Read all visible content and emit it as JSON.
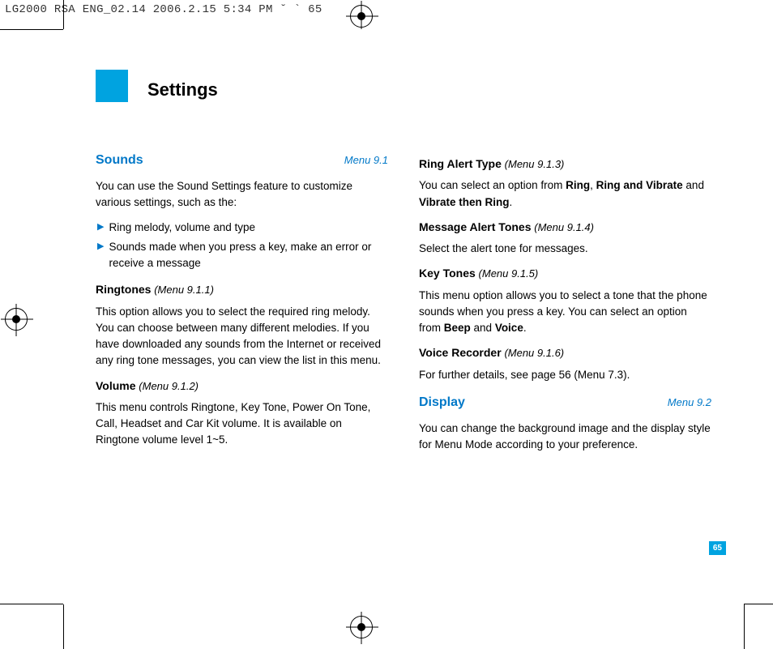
{
  "header": "LG2000 RSA ENG_02.14  2006.2.15 5:34 PM  ˘ ` 65",
  "page_title": "Settings",
  "page_number": "65",
  "left": {
    "section": {
      "title": "Sounds",
      "menu": "Menu 9.1"
    },
    "intro": "You can use the Sound Settings feature to customize various settings, such as the:",
    "bullets": [
      "Ring melody, volume and type",
      "Sounds made when you press a key, make an error or receive a message"
    ],
    "ringtones": {
      "title": "Ringtones",
      "menu": "(Menu 9.1.1)",
      "body": "This option allows you to select the required ring melody. You can choose between many different melodies. If you have downloaded any sounds from the Internet or received any ring tone messages, you can view the list in this menu."
    },
    "volume": {
      "title": "Volume",
      "menu": "(Menu 9.1.2)",
      "body": "This menu controls Ringtone, Key Tone, Power On Tone, Call, Headset and Car Kit volume. It is available on Ringtone volume level 1~5."
    }
  },
  "right": {
    "ringalert": {
      "title": "Ring Alert Type",
      "menu": "(Menu 9.1.3)",
      "pre": "You can select an option from ",
      "b1": "Ring",
      "mid1": ", ",
      "b2": "Ring and Vibrate",
      "mid2": " and ",
      "b3": "Vibrate then Ring",
      "post": "."
    },
    "msgalert": {
      "title": "Message Alert Tones",
      "menu": "(Menu 9.1.4)",
      "body": "Select the alert tone for messages."
    },
    "keytones": {
      "title": "Key Tones",
      "menu": "(Menu 9.1.5)",
      "pre": "This menu option allows you to select a tone that the phone sounds when you press a key. You can select an option from ",
      "b1": "Beep",
      "mid": " and ",
      "b2": "Voice",
      "post": "."
    },
    "voicerec": {
      "title": "Voice Recorder",
      "menu": "(Menu 9.1.6)",
      "body": "For further details, see page 56 (Menu 7.3)."
    },
    "display": {
      "title": "Display",
      "menu": "Menu 9.2",
      "body": "You can change the background image and the display style for Menu Mode according to your preference."
    }
  }
}
